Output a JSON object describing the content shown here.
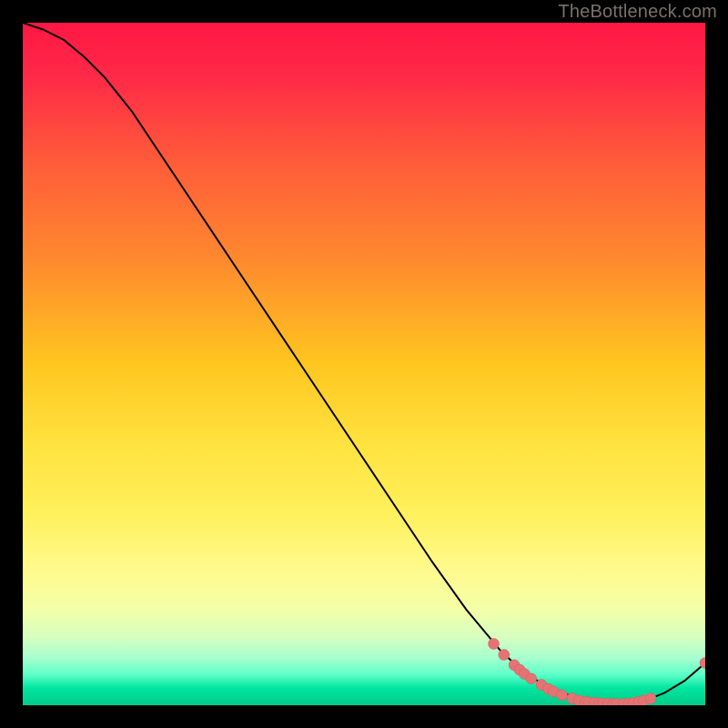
{
  "attribution": "TheBottleneck.com",
  "colors": {
    "curve": "#000000",
    "point_fill": "#e57373",
    "point_stroke": "#c96262",
    "gradient_top": "#ff1744",
    "gradient_bottom": "#00cc88"
  },
  "chart_data": {
    "type": "line",
    "title": "",
    "xlabel": "",
    "ylabel": "",
    "xlim": [
      0,
      100
    ],
    "ylim": [
      0,
      100
    ],
    "series": [
      {
        "name": "bottleneck_curve",
        "x": [
          0,
          3,
          6,
          9,
          12,
          16,
          20,
          25,
          30,
          35,
          40,
          45,
          50,
          55,
          60,
          65,
          70,
          73,
          76,
          79,
          82,
          85,
          88,
          91,
          94,
          97,
          100
        ],
        "y": [
          100,
          99,
          97.5,
          95,
          92,
          87,
          81,
          73.5,
          66,
          58.5,
          51,
          43.5,
          36,
          28.5,
          21,
          14,
          8,
          5.2,
          3.2,
          1.8,
          0.9,
          0.35,
          0.2,
          0.6,
          1.8,
          3.6,
          6.2
        ]
      }
    ],
    "scatter_points": [
      {
        "x": 69.0,
        "y": 9.0
      },
      {
        "x": 70.5,
        "y": 7.4
      },
      {
        "x": 72.0,
        "y": 5.9
      },
      {
        "x": 72.8,
        "y": 5.2
      },
      {
        "x": 73.5,
        "y": 4.6
      },
      {
        "x": 74.5,
        "y": 3.9
      },
      {
        "x": 76.0,
        "y": 3.0
      },
      {
        "x": 77.0,
        "y": 2.4
      },
      {
        "x": 77.8,
        "y": 2.0
      },
      {
        "x": 79.0,
        "y": 1.5
      },
      {
        "x": 80.5,
        "y": 1.0
      },
      {
        "x": 81.5,
        "y": 0.7
      },
      {
        "x": 82.5,
        "y": 0.5
      },
      {
        "x": 83.0,
        "y": 0.4
      },
      {
        "x": 83.8,
        "y": 0.35
      },
      {
        "x": 84.5,
        "y": 0.3
      },
      {
        "x": 85.0,
        "y": 0.25
      },
      {
        "x": 85.8,
        "y": 0.22
      },
      {
        "x": 86.5,
        "y": 0.2
      },
      {
        "x": 87.0,
        "y": 0.2
      },
      {
        "x": 88.0,
        "y": 0.2
      },
      {
        "x": 88.8,
        "y": 0.25
      },
      {
        "x": 89.5,
        "y": 0.35
      },
      {
        "x": 90.3,
        "y": 0.5
      },
      {
        "x": 91.0,
        "y": 0.7
      },
      {
        "x": 92.0,
        "y": 1.0
      },
      {
        "x": 100.0,
        "y": 6.2
      }
    ]
  }
}
